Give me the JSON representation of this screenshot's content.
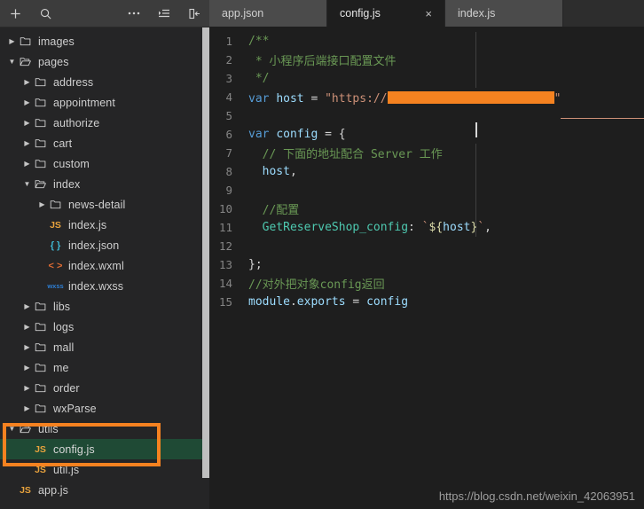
{
  "sidebar": {
    "toolbar": [
      {
        "name": "new-file-button",
        "icon": "plus-icon"
      },
      {
        "name": "search-button",
        "icon": "search-icon"
      },
      {
        "name": "more-actions-button",
        "icon": "ellipsis-icon"
      },
      {
        "name": "collapse-list-button",
        "icon": "list-collapse-icon"
      },
      {
        "name": "collapse-sidebar-button",
        "icon": "panel-collapse-left-icon"
      }
    ],
    "tree": [
      {
        "label": "images",
        "type": "folder",
        "depth": 0,
        "state": "collapsed",
        "icon": "folder-icon"
      },
      {
        "label": "pages",
        "type": "folder",
        "depth": 0,
        "state": "expanded",
        "icon": "folder-open-icon"
      },
      {
        "label": "address",
        "type": "folder",
        "depth": 1,
        "state": "collapsed",
        "icon": "folder-icon"
      },
      {
        "label": "appointment",
        "type": "folder",
        "depth": 1,
        "state": "collapsed",
        "icon": "folder-icon"
      },
      {
        "label": "authorize",
        "type": "folder",
        "depth": 1,
        "state": "collapsed",
        "icon": "folder-icon"
      },
      {
        "label": "cart",
        "type": "folder",
        "depth": 1,
        "state": "collapsed",
        "icon": "folder-icon"
      },
      {
        "label": "custom",
        "type": "folder",
        "depth": 1,
        "state": "collapsed",
        "icon": "folder-icon"
      },
      {
        "label": "index",
        "type": "folder",
        "depth": 1,
        "state": "expanded",
        "icon": "folder-open-icon"
      },
      {
        "label": "news-detail",
        "type": "folder",
        "depth": 2,
        "state": "collapsed",
        "icon": "folder-icon"
      },
      {
        "label": "index.js",
        "type": "file",
        "depth": 2,
        "icon": "js-file-icon",
        "badge": "JS"
      },
      {
        "label": "index.json",
        "type": "file",
        "depth": 2,
        "icon": "json-file-icon",
        "badge": "{ }"
      },
      {
        "label": "index.wxml",
        "type": "file",
        "depth": 2,
        "icon": "wxml-file-icon",
        "badge": "< >"
      },
      {
        "label": "index.wxss",
        "type": "file",
        "depth": 2,
        "icon": "wxss-file-icon",
        "badge": "wxss"
      },
      {
        "label": "libs",
        "type": "folder",
        "depth": 1,
        "state": "collapsed",
        "icon": "folder-icon"
      },
      {
        "label": "logs",
        "type": "folder",
        "depth": 1,
        "state": "collapsed",
        "icon": "folder-icon"
      },
      {
        "label": "mall",
        "type": "folder",
        "depth": 1,
        "state": "collapsed",
        "icon": "folder-icon"
      },
      {
        "label": "me",
        "type": "folder",
        "depth": 1,
        "state": "collapsed",
        "icon": "folder-icon"
      },
      {
        "label": "order",
        "type": "folder",
        "depth": 1,
        "state": "collapsed",
        "icon": "folder-icon"
      },
      {
        "label": "wxParse",
        "type": "folder",
        "depth": 1,
        "state": "collapsed",
        "icon": "folder-icon"
      },
      {
        "label": "utils",
        "type": "folder",
        "depth": 0,
        "state": "expanded",
        "icon": "folder-open-icon"
      },
      {
        "label": "config.js",
        "type": "file",
        "depth": 1,
        "icon": "js-file-icon",
        "badge": "JS",
        "selected": true
      },
      {
        "label": "util.js",
        "type": "file",
        "depth": 1,
        "icon": "js-file-icon",
        "badge": "JS"
      },
      {
        "label": "app.js",
        "type": "file",
        "depth": 0,
        "icon": "js-file-icon",
        "badge": "JS"
      }
    ],
    "annotation": {
      "name": "highlight-box",
      "color": "#f58220"
    },
    "selection_color": "#1f4a35"
  },
  "editor": {
    "tabs": [
      {
        "label": "app.json",
        "active": false,
        "closable": false
      },
      {
        "label": "config.js",
        "active": true,
        "closable": true,
        "close_glyph": "×"
      },
      {
        "label": "index.js",
        "active": false,
        "closable": false
      }
    ],
    "lines": [
      {
        "n": "1",
        "segments": [
          {
            "t": "/**",
            "c": "t-cm"
          }
        ]
      },
      {
        "n": "2",
        "segments": [
          {
            "t": " * 小程序后端接口配置文件",
            "c": "t-cm"
          }
        ]
      },
      {
        "n": "3",
        "segments": [
          {
            "t": " */",
            "c": "t-cm"
          }
        ]
      },
      {
        "n": "4",
        "segments": [
          {
            "t": "var",
            "c": "t-kw"
          },
          {
            "t": " ",
            "c": "t-op"
          },
          {
            "t": "host",
            "c": "t-var"
          },
          {
            "t": " = ",
            "c": "t-op"
          },
          {
            "t": "\"https://",
            "c": "t-str"
          },
          {
            "t": "REDACTED",
            "c": "redact-token"
          },
          {
            "t": "\"",
            "c": "t-str"
          }
        ]
      },
      {
        "n": "5",
        "segments": []
      },
      {
        "n": "6",
        "segments": [
          {
            "t": "var",
            "c": "t-kw"
          },
          {
            "t": " ",
            "c": "t-op"
          },
          {
            "t": "config",
            "c": "t-var"
          },
          {
            "t": " = {",
            "c": "t-op"
          }
        ]
      },
      {
        "n": "7",
        "segments": [
          {
            "t": "  // 下面的地址配合 Server 工作",
            "c": "t-cm"
          }
        ]
      },
      {
        "n": "8",
        "segments": [
          {
            "t": "  ",
            "c": "t-op"
          },
          {
            "t": "host",
            "c": "t-var"
          },
          {
            "t": ",",
            "c": "t-pun"
          }
        ]
      },
      {
        "n": "9",
        "segments": []
      },
      {
        "n": "10",
        "segments": [
          {
            "t": "  //配置",
            "c": "t-cm"
          }
        ]
      },
      {
        "n": "11",
        "segments": [
          {
            "t": "  ",
            "c": "t-op"
          },
          {
            "t": "GetReserveShop_config",
            "c": "t-fn"
          },
          {
            "t": ": ",
            "c": "t-pun"
          },
          {
            "t": "`",
            "c": "t-tpl"
          },
          {
            "t": "${",
            "c": "t-brc"
          },
          {
            "t": "host",
            "c": "t-var"
          },
          {
            "t": "}",
            "c": "t-brc"
          },
          {
            "t": "`",
            "c": "t-tpl"
          },
          {
            "t": ",",
            "c": "t-pun"
          }
        ]
      },
      {
        "n": "12",
        "segments": []
      },
      {
        "n": "13",
        "segments": [
          {
            "t": "};",
            "c": "t-op"
          }
        ]
      },
      {
        "n": "14",
        "segments": [
          {
            "t": "//对外把对象config返回",
            "c": "t-cm"
          }
        ]
      },
      {
        "n": "15",
        "segments": [
          {
            "t": "module",
            "c": "t-var"
          },
          {
            "t": ".",
            "c": "t-pun"
          },
          {
            "t": "exports",
            "c": "t-var"
          },
          {
            "t": " = ",
            "c": "t-op"
          },
          {
            "t": "config",
            "c": "t-var"
          }
        ]
      }
    ],
    "redacted_host": {
      "name": "redacted-url-bar",
      "color": "#f58220"
    }
  },
  "watermark": {
    "text": "https://blog.csdn.net/weixin_42063951"
  }
}
